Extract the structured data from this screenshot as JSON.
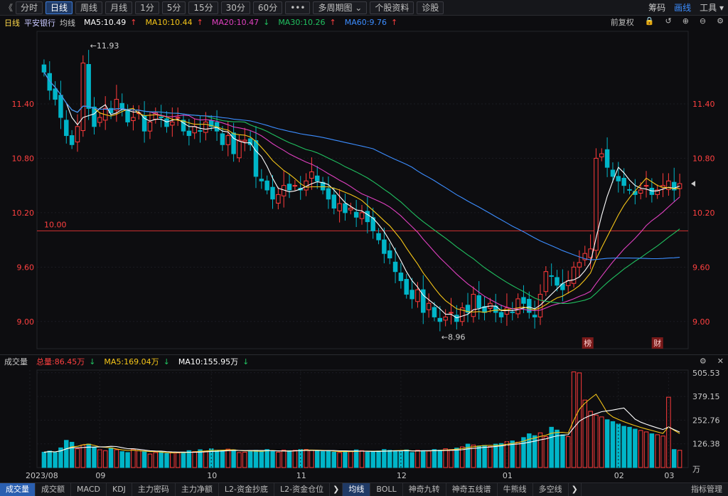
{
  "toolbar": {
    "back_icon": "double-chevron-left-icon",
    "tabs": [
      "分时",
      "日线",
      "周线",
      "月线",
      "1分",
      "5分",
      "15分",
      "30分",
      "60分"
    ],
    "active_tab": "日线",
    "more_label": "•••",
    "multi_period": "多周期图",
    "stock_info": "个股资料",
    "diagnose": "诊股",
    "right": [
      "筹码",
      "画线",
      "工具"
    ]
  },
  "ma_bar": {
    "period": "日线",
    "name": "平安银行",
    "avg_label": "均线",
    "ma5": "MA5:10.49",
    "ma10": "MA10:10.44",
    "ma20": "MA20:10.47",
    "ma30": "MA30:10.26",
    "ma60": "MA60:9.76",
    "ma5_arrow": "↑",
    "ma10_arrow": "↑",
    "ma20_arrow": "↓",
    "ma30_arrow": "↑",
    "ma60_arrow": "↑",
    "adjust": "前复权"
  },
  "vol_bar": {
    "title": "成交量",
    "total": "总量:86.45万",
    "ma5": "MA5:169.04万",
    "ma10": "MA10:155.95万",
    "total_arrow": "↓",
    "ma5_arrow": "↓",
    "ma10_arrow": "↓"
  },
  "bottom_tabs": [
    "成交量",
    "成交额",
    "MACD",
    "KDJ",
    "主力密码",
    "主力净额",
    "L2-资金抄底",
    "L2-资金仓位",
    "均线",
    "BOLL",
    "神奇九转",
    "神奇五线谱",
    "牛熊线",
    "多空线",
    "指标管理"
  ],
  "bottom_active": [
    "成交量",
    "均线"
  ],
  "colors": {
    "up": "#ff3b3b",
    "down": "#00b5c8",
    "ma5": "#ffffff",
    "ma10": "#f5c518",
    "ma20": "#e040c0",
    "ma30": "#20c060",
    "ma60": "#3c8dff",
    "refline": "#d03030",
    "axis_text": "#ff4040"
  },
  "chart_data": [
    {
      "type": "candlestick",
      "title": "平安银行 日线",
      "y_ticks": [
        "11.40",
        "10.80",
        "10.20",
        "9.60",
        "9.00"
      ],
      "ylim": [
        8.7,
        12.2
      ],
      "reference_line": {
        "value": 10.0,
        "label": "10.00"
      },
      "high_marker": "←11.93",
      "low_marker": "←8.96",
      "badges": [
        "榜",
        "财"
      ],
      "close": [
        11.75,
        11.55,
        11.45,
        11.25,
        11.05,
        10.95,
        11.15,
        11.85,
        11.35,
        11.15,
        11.25,
        11.35,
        11.3,
        11.45,
        11.35,
        11.2,
        11.25,
        11.3,
        11.1,
        11.2,
        11.3,
        11.25,
        11.15,
        11.2,
        11.25,
        11.1,
        11.05,
        11.15,
        11.1,
        11.2,
        11.15,
        11.1,
        10.95,
        11.05,
        10.85,
        11.0,
        11.0,
        10.95,
        10.6,
        10.55,
        10.45,
        10.35,
        10.4,
        10.5,
        10.45,
        10.5,
        10.45,
        10.55,
        10.65,
        10.55,
        10.45,
        10.35,
        10.25,
        10.3,
        10.2,
        10.25,
        10.15,
        10.2,
        10.1,
        10.0,
        9.9,
        9.75,
        9.7,
        9.55,
        9.45,
        9.3,
        9.25,
        9.35,
        9.1,
        9.2,
        9.05,
        9.0,
        9.05,
        9.1,
        9.0,
        9.15,
        9.1,
        9.3,
        9.15,
        9.1,
        9.2,
        9.1,
        9.05,
        9.15,
        9.1,
        9.25,
        9.2,
        9.1,
        9.05,
        9.3,
        9.55,
        9.5,
        9.4,
        9.35,
        9.45,
        9.6,
        9.65,
        9.75,
        9.8,
        10.8,
        10.85,
        10.7,
        10.6,
        10.55,
        10.5,
        10.45,
        10.4,
        10.45,
        10.5,
        10.4,
        10.45,
        10.5,
        10.55,
        10.45,
        10.52
      ],
      "volume": [
        82,
        88,
        80,
        105,
        145,
        135,
        100,
        120,
        125,
        110,
        95,
        90,
        105,
        95,
        85,
        80,
        98,
        90,
        85,
        72,
        80,
        85,
        75,
        80,
        78,
        82,
        90,
        85,
        95,
        88,
        100,
        92,
        90,
        98,
        94,
        80,
        82,
        90,
        92,
        88,
        96,
        85,
        82,
        93,
        90,
        92,
        96,
        96,
        92,
        88,
        85,
        90,
        82,
        80,
        88,
        85,
        94,
        90,
        82,
        84,
        88,
        96,
        92,
        90,
        88,
        94,
        80,
        92,
        90,
        88,
        96,
        93,
        100,
        96,
        104,
        110,
        125,
        120,
        115,
        118,
        112,
        125,
        128,
        138,
        142,
        135,
        160,
        180,
        170,
        185,
        165,
        215,
        200,
        175,
        165,
        510,
        505,
        360,
        300,
        280,
        270,
        255,
        245,
        232,
        220,
        215,
        205,
        198,
        190,
        180,
        175,
        168,
        375,
        96,
        92
      ],
      "volume_y_ticks": [
        "505.53",
        "379.15",
        "252.76",
        "126.38",
        "万"
      ],
      "volume_ylim": [
        0,
        520
      ],
      "x_labels": [
        "2023/08",
        "09",
        "10",
        "11",
        "12",
        "01",
        "02",
        "03"
      ]
    }
  ]
}
